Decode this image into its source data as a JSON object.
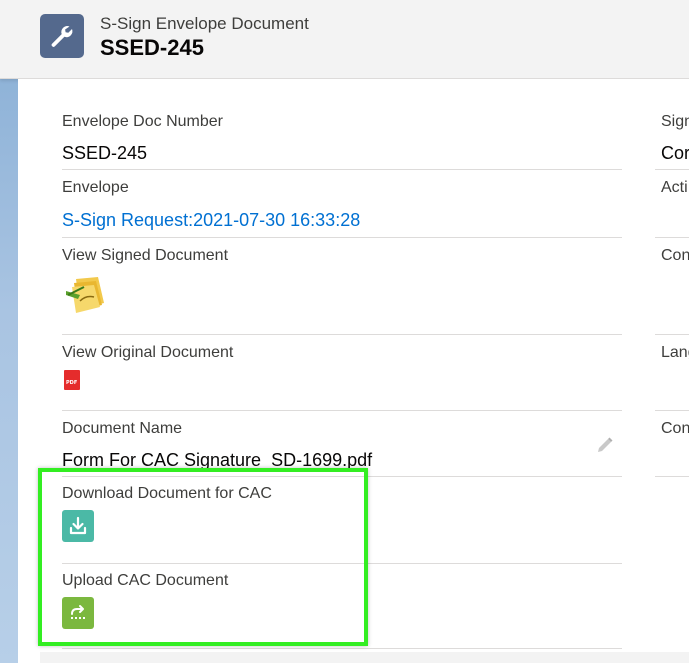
{
  "header": {
    "object_type": "S-Sign Envelope Document",
    "record_title": "SSED-245",
    "icon": "wrench-icon",
    "icon_color": "#54698d"
  },
  "fields": {
    "envelope_doc_number": {
      "label": "Envelope Doc Number",
      "value": "SSED-245"
    },
    "envelope": {
      "label": "Envelope",
      "value": "S-Sign Request:2021-07-30 16:33:28"
    },
    "view_signed_document": {
      "label": "View Signed Document",
      "icon": "signed-document-icon"
    },
    "view_original_document": {
      "label": "View Original Document",
      "icon": "pdf-icon"
    },
    "document_name": {
      "label": "Document Name",
      "value": "Form For CAC Signature_SD-1699.pdf",
      "edit_icon": "pencil-icon"
    },
    "download_cac": {
      "label": "Download Document for CAC",
      "icon": "download-icon",
      "icon_color": "#4bb9a6"
    },
    "upload_cac": {
      "label": "Upload CAC Document",
      "icon": "upload-icon",
      "icon_color": "#7bb83f"
    }
  },
  "right_column": {
    "row1_label": "Sign",
    "row1_value": "Cor",
    "row2_label": "Acti",
    "row3_label": "Con",
    "row4_label": "Lang",
    "row5_label": "Con"
  },
  "colors": {
    "link": "#0070d2",
    "highlight_border": "#33ee22",
    "header_bg": "#f3f3f3"
  }
}
